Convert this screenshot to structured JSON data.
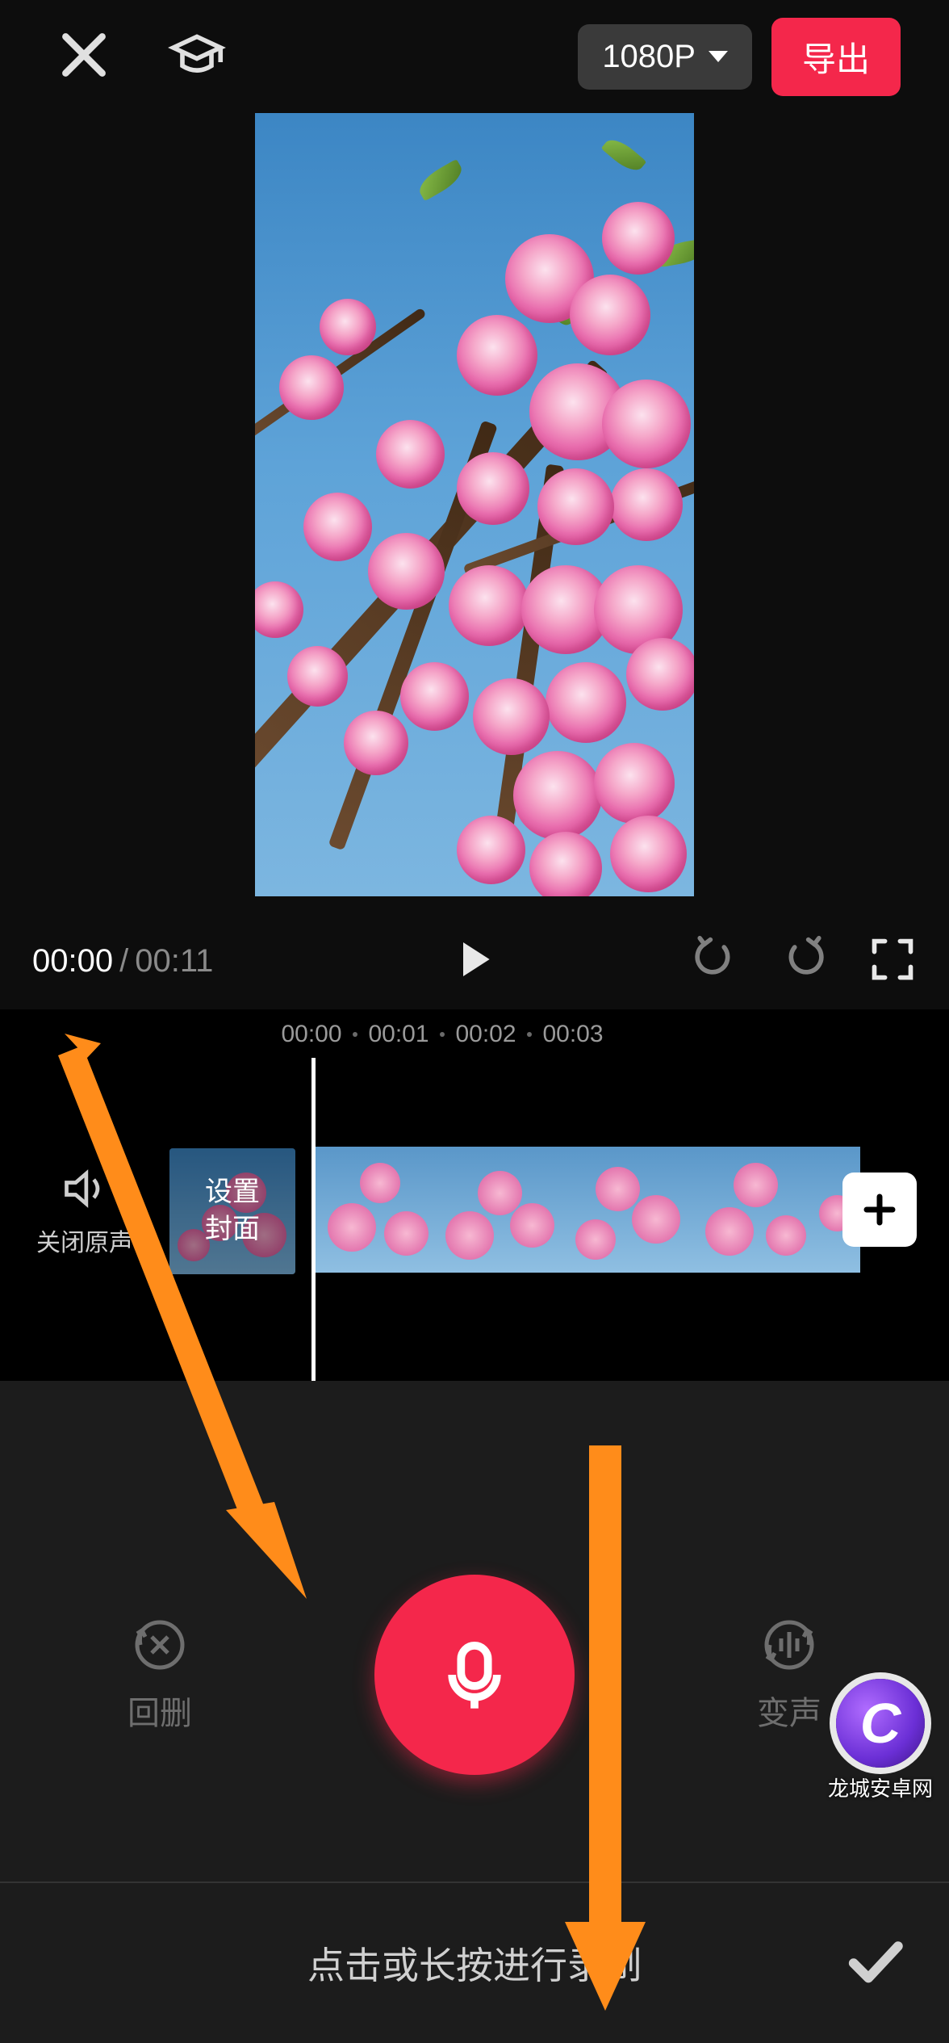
{
  "header": {
    "resolution_label": "1080P",
    "export_label": "导出"
  },
  "playback": {
    "current_time": "00:00",
    "duration": "00:11"
  },
  "ruler": {
    "marks": [
      "00:00",
      "00:01",
      "00:02",
      "00:03"
    ]
  },
  "timeline": {
    "mute_label": "关闭原声",
    "cover_label": "设置\n封面"
  },
  "record": {
    "delete_label": "回删",
    "voice_change_label": "变声"
  },
  "confirm": {
    "hint": "点击或长按进行录制"
  },
  "watermark": {
    "text": "龙城安卓网"
  }
}
